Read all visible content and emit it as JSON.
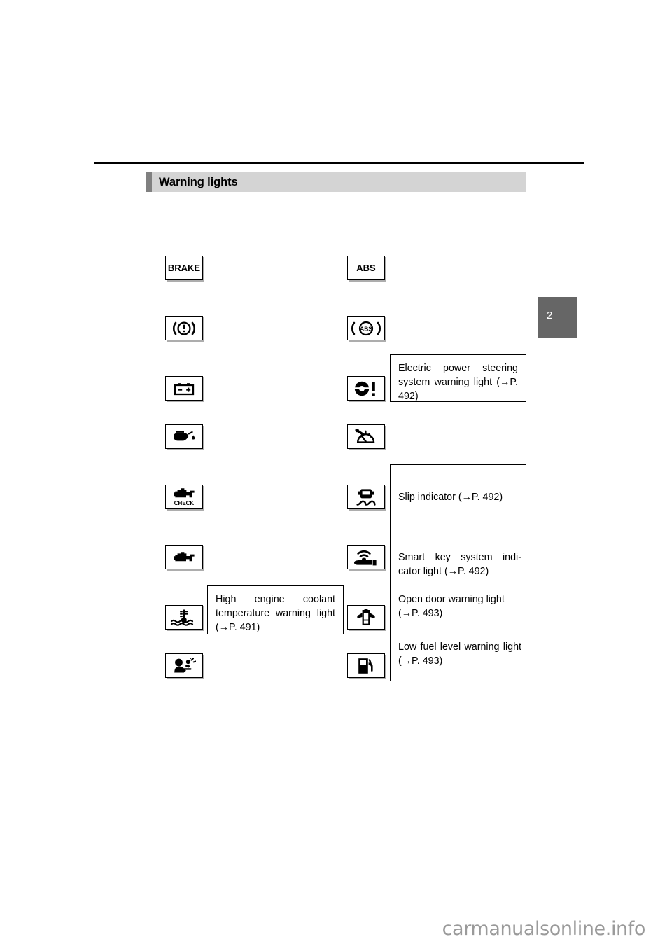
{
  "page": {
    "chapter_tab": "2",
    "watermark": "carmanualsonline.info"
  },
  "header": {
    "title": "Warning lights"
  },
  "left_column": [
    {
      "icon": "brake-text-icon",
      "label": "BRAKE"
    },
    {
      "icon": "brake-system-icon",
      "label": ""
    },
    {
      "icon": "battery-charge-icon",
      "label": ""
    },
    {
      "icon": "engine-oil-pressure-icon",
      "label": ""
    },
    {
      "icon": "check-engine-icon",
      "label": "CHECK"
    },
    {
      "icon": "malfunction-indicator-icon",
      "label": ""
    },
    {
      "icon": "engine-coolant-temp-icon",
      "label": ""
    },
    {
      "icon": "srs-airbag-icon",
      "label": ""
    }
  ],
  "right_column": [
    {
      "icon": "abs-text-icon",
      "label": "ABS"
    },
    {
      "icon": "abs-ring-icon",
      "label": ""
    },
    {
      "icon": "electric-power-steering-icon",
      "label": ""
    },
    {
      "icon": "cruise-cancel-icon",
      "label": ""
    },
    {
      "icon": "slip-indicator-icon",
      "label": ""
    },
    {
      "icon": "smart-key-icon",
      "label": ""
    },
    {
      "icon": "open-door-icon",
      "label": ""
    },
    {
      "icon": "low-fuel-icon",
      "label": ""
    }
  ],
  "captions": {
    "eps": "Electric power steering system warning light (→P. 492)",
    "slip": "Slip indicator (→P. 492)",
    "smart_key": "Smart key system indi-cator light (→P. 492)",
    "open_door": "Open door warning light (→P. 493)",
    "low_fuel": "Low fuel level warning light (→P. 493)",
    "coolant": "High engine coolant temperature warning light (→P. 491)"
  }
}
